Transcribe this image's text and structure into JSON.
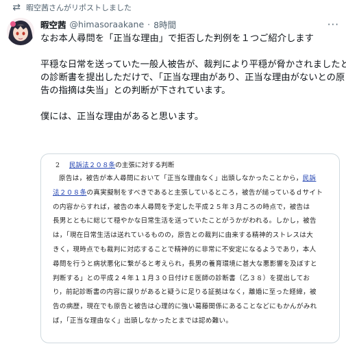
{
  "repost": {
    "icon": "repost-icon",
    "text": "暇空茜さんがリポストしました"
  },
  "author": {
    "name": "暇空茜",
    "handle": "@himasoraakane",
    "separator": "·",
    "time": "8時間"
  },
  "more_icon": "ellipsis-icon",
  "tweet_lines": [
    "なお本人尋問を「正当な理由」で拒否した判例を１つご紹介します",
    "",
    "平穏な日常を送っていた一般人被告が、裁判により平穏が脅かされましたと",
    "の診断書を提出しただけで、「正当な理由があり、正当な理由がないとの原",
    "告の指摘は失当」との判断が下されています。",
    "",
    "僕には、正当な理由があると思います。"
  ],
  "document": {
    "heading_num": "2",
    "heading_link": "民訴法２０８条",
    "heading_rest": "の主張に対する判断",
    "lines": [
      {
        "pre": "原告は，被告が本人尋問において「正当な理由なく」出頭しなかったことから，",
        "link": "民訴",
        "post": "",
        "indent": true
      },
      {
        "pre": "",
        "link": "法２０８条",
        "post": "の真実擬制をすべきであると主張しているところ，被告が縋っているｄサイト",
        "indent": false
      },
      {
        "pre": "の内容からすれば，被告の本人尋問を予定した平成２５年３月ころの時点で，被告は",
        "link": "",
        "post": "",
        "indent": false
      },
      {
        "pre": "長男とともに総じて穏やかな日常生活を送っていたことがうかがわれる。しかし，被告",
        "link": "",
        "post": "",
        "indent": false
      },
      {
        "pre": "は，「現在日常生活は送れているものの，原告との裁判に由来する精神的ストレスは大",
        "link": "",
        "post": "",
        "indent": false
      },
      {
        "pre": "きく，現時点でも裁判に対応することで精神的に非常に不安定になるようであり，本人",
        "link": "",
        "post": "",
        "indent": false
      },
      {
        "pre": "尋問を行うと病状悪化に繋がると考えられ，長男の養育環境に甚大な悪影響を及ぼすと",
        "link": "",
        "post": "",
        "indent": false
      },
      {
        "pre": "判断する」との平成２４年１１月３０日付けＥ医師の診断書（乙３８）を提出してお",
        "link": "",
        "post": "",
        "indent": false
      },
      {
        "pre": "り，前記診断書の内容に誤りがあると疑うに足りる証拠はなく，離婚に至った経緯，被",
        "link": "",
        "post": "",
        "indent": false
      },
      {
        "pre": "告の病歴，現在でも原告と被告は心理的に強い葛藤関係にあることなどにもかんがみれ",
        "link": "",
        "post": "",
        "indent": false
      },
      {
        "pre": "ば，「正当な理由なく」出頭しなかったとまでは認め難い。",
        "link": "",
        "post": "",
        "indent": false
      }
    ]
  },
  "colors": {
    "text": "#0f1419",
    "secondary": "#536471",
    "link": "#1d3fb0",
    "border": "#cfd9de"
  }
}
